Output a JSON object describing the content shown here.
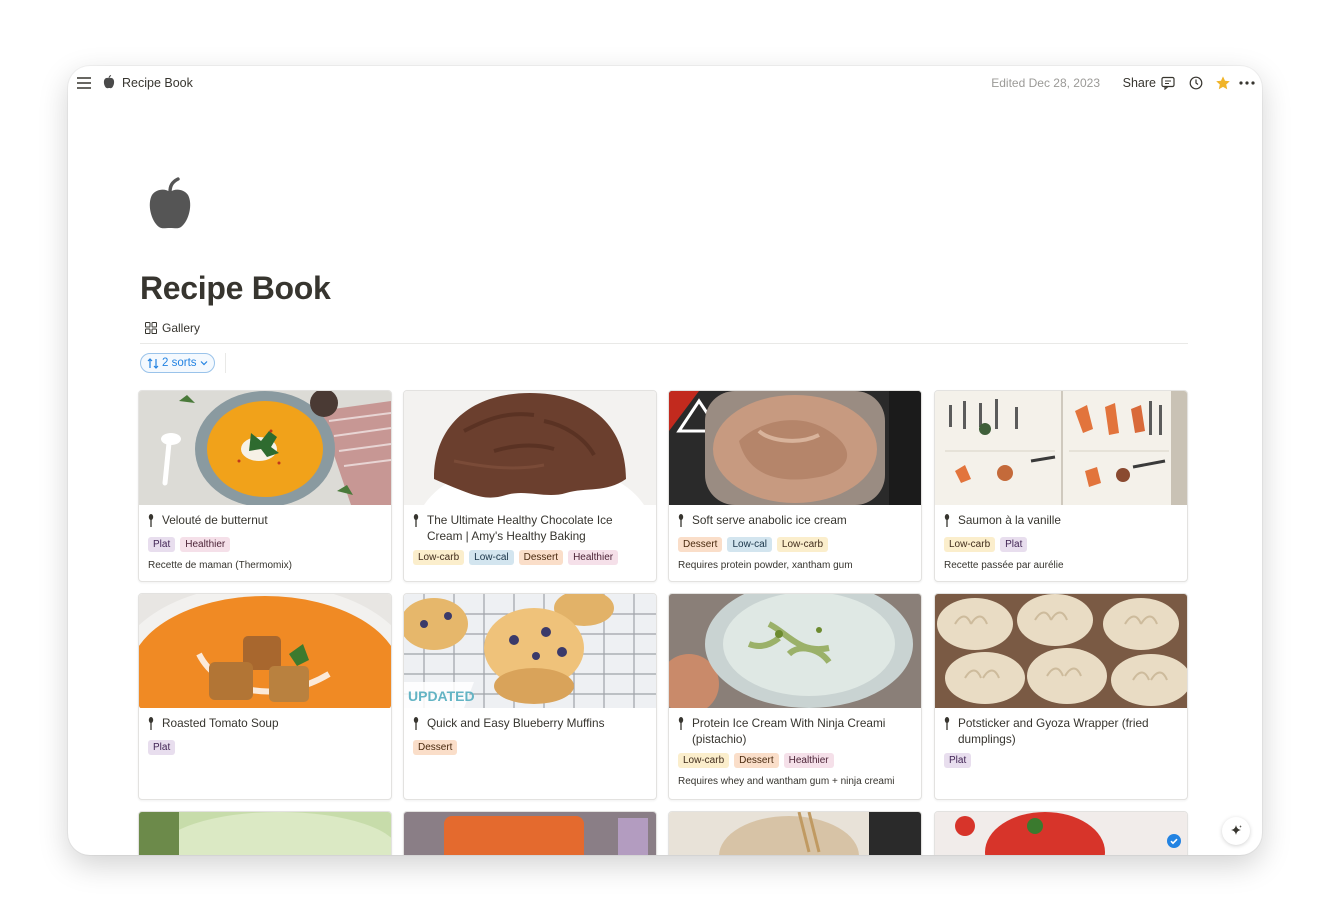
{
  "breadcrumb": {
    "title": "Recipe Book"
  },
  "topbar": {
    "edited": "Edited Dec 28, 2023",
    "share": "Share"
  },
  "page": {
    "title": "Recipe Book",
    "view_tab": "Gallery",
    "sort_label": "2 sorts"
  },
  "tag_colors": {
    "Plat": {
      "bg": "#e8deee",
      "fg": "#412454"
    },
    "Healthier": {
      "bg": "#f5e0e9",
      "fg": "#4c2337"
    },
    "Low-carb": {
      "bg": "#fbeecc",
      "fg": "#402c1b"
    },
    "Low-cal": {
      "bg": "#d3e5ef",
      "fg": "#183347"
    },
    "Dessert": {
      "bg": "#fadec9",
      "fg": "#49290e"
    }
  },
  "cards": [
    {
      "title": "Velouté de butternut",
      "tags": [
        "Plat",
        "Healthier"
      ],
      "note": "Recette de maman (Thermomix)"
    },
    {
      "title": "The Ultimate Healthy Chocolate Ice Cream | Amy's Healthy Baking",
      "tags": [
        "Low-carb",
        "Low-cal",
        "Dessert",
        "Healthier"
      ],
      "note": ""
    },
    {
      "title": "Soft serve anabolic ice cream",
      "tags": [
        "Dessert",
        "Low-cal",
        "Low-carb"
      ],
      "note": "Requires protein powder, xantham gum"
    },
    {
      "title": "Saumon à la vanille",
      "tags": [
        "Low-carb",
        "Plat"
      ],
      "note": "Recette passée par aurélie"
    },
    {
      "title": "Roasted Tomato Soup",
      "tags": [
        "Plat"
      ],
      "note": ""
    },
    {
      "title": "Quick and Easy Blueberry Muffins",
      "tags": [
        "Dessert"
      ],
      "note": "",
      "cover_text": "UPDATED"
    },
    {
      "title": "Protein Ice Cream With Ninja Creami (pistachio)",
      "tags": [
        "Low-carb",
        "Dessert",
        "Healthier"
      ],
      "note": "Requires whey and wantham gum + ninja creami"
    },
    {
      "title": "Potsticker and Gyoza Wrapper (fried dumplings)",
      "tags": [
        "Plat"
      ],
      "note": ""
    }
  ]
}
